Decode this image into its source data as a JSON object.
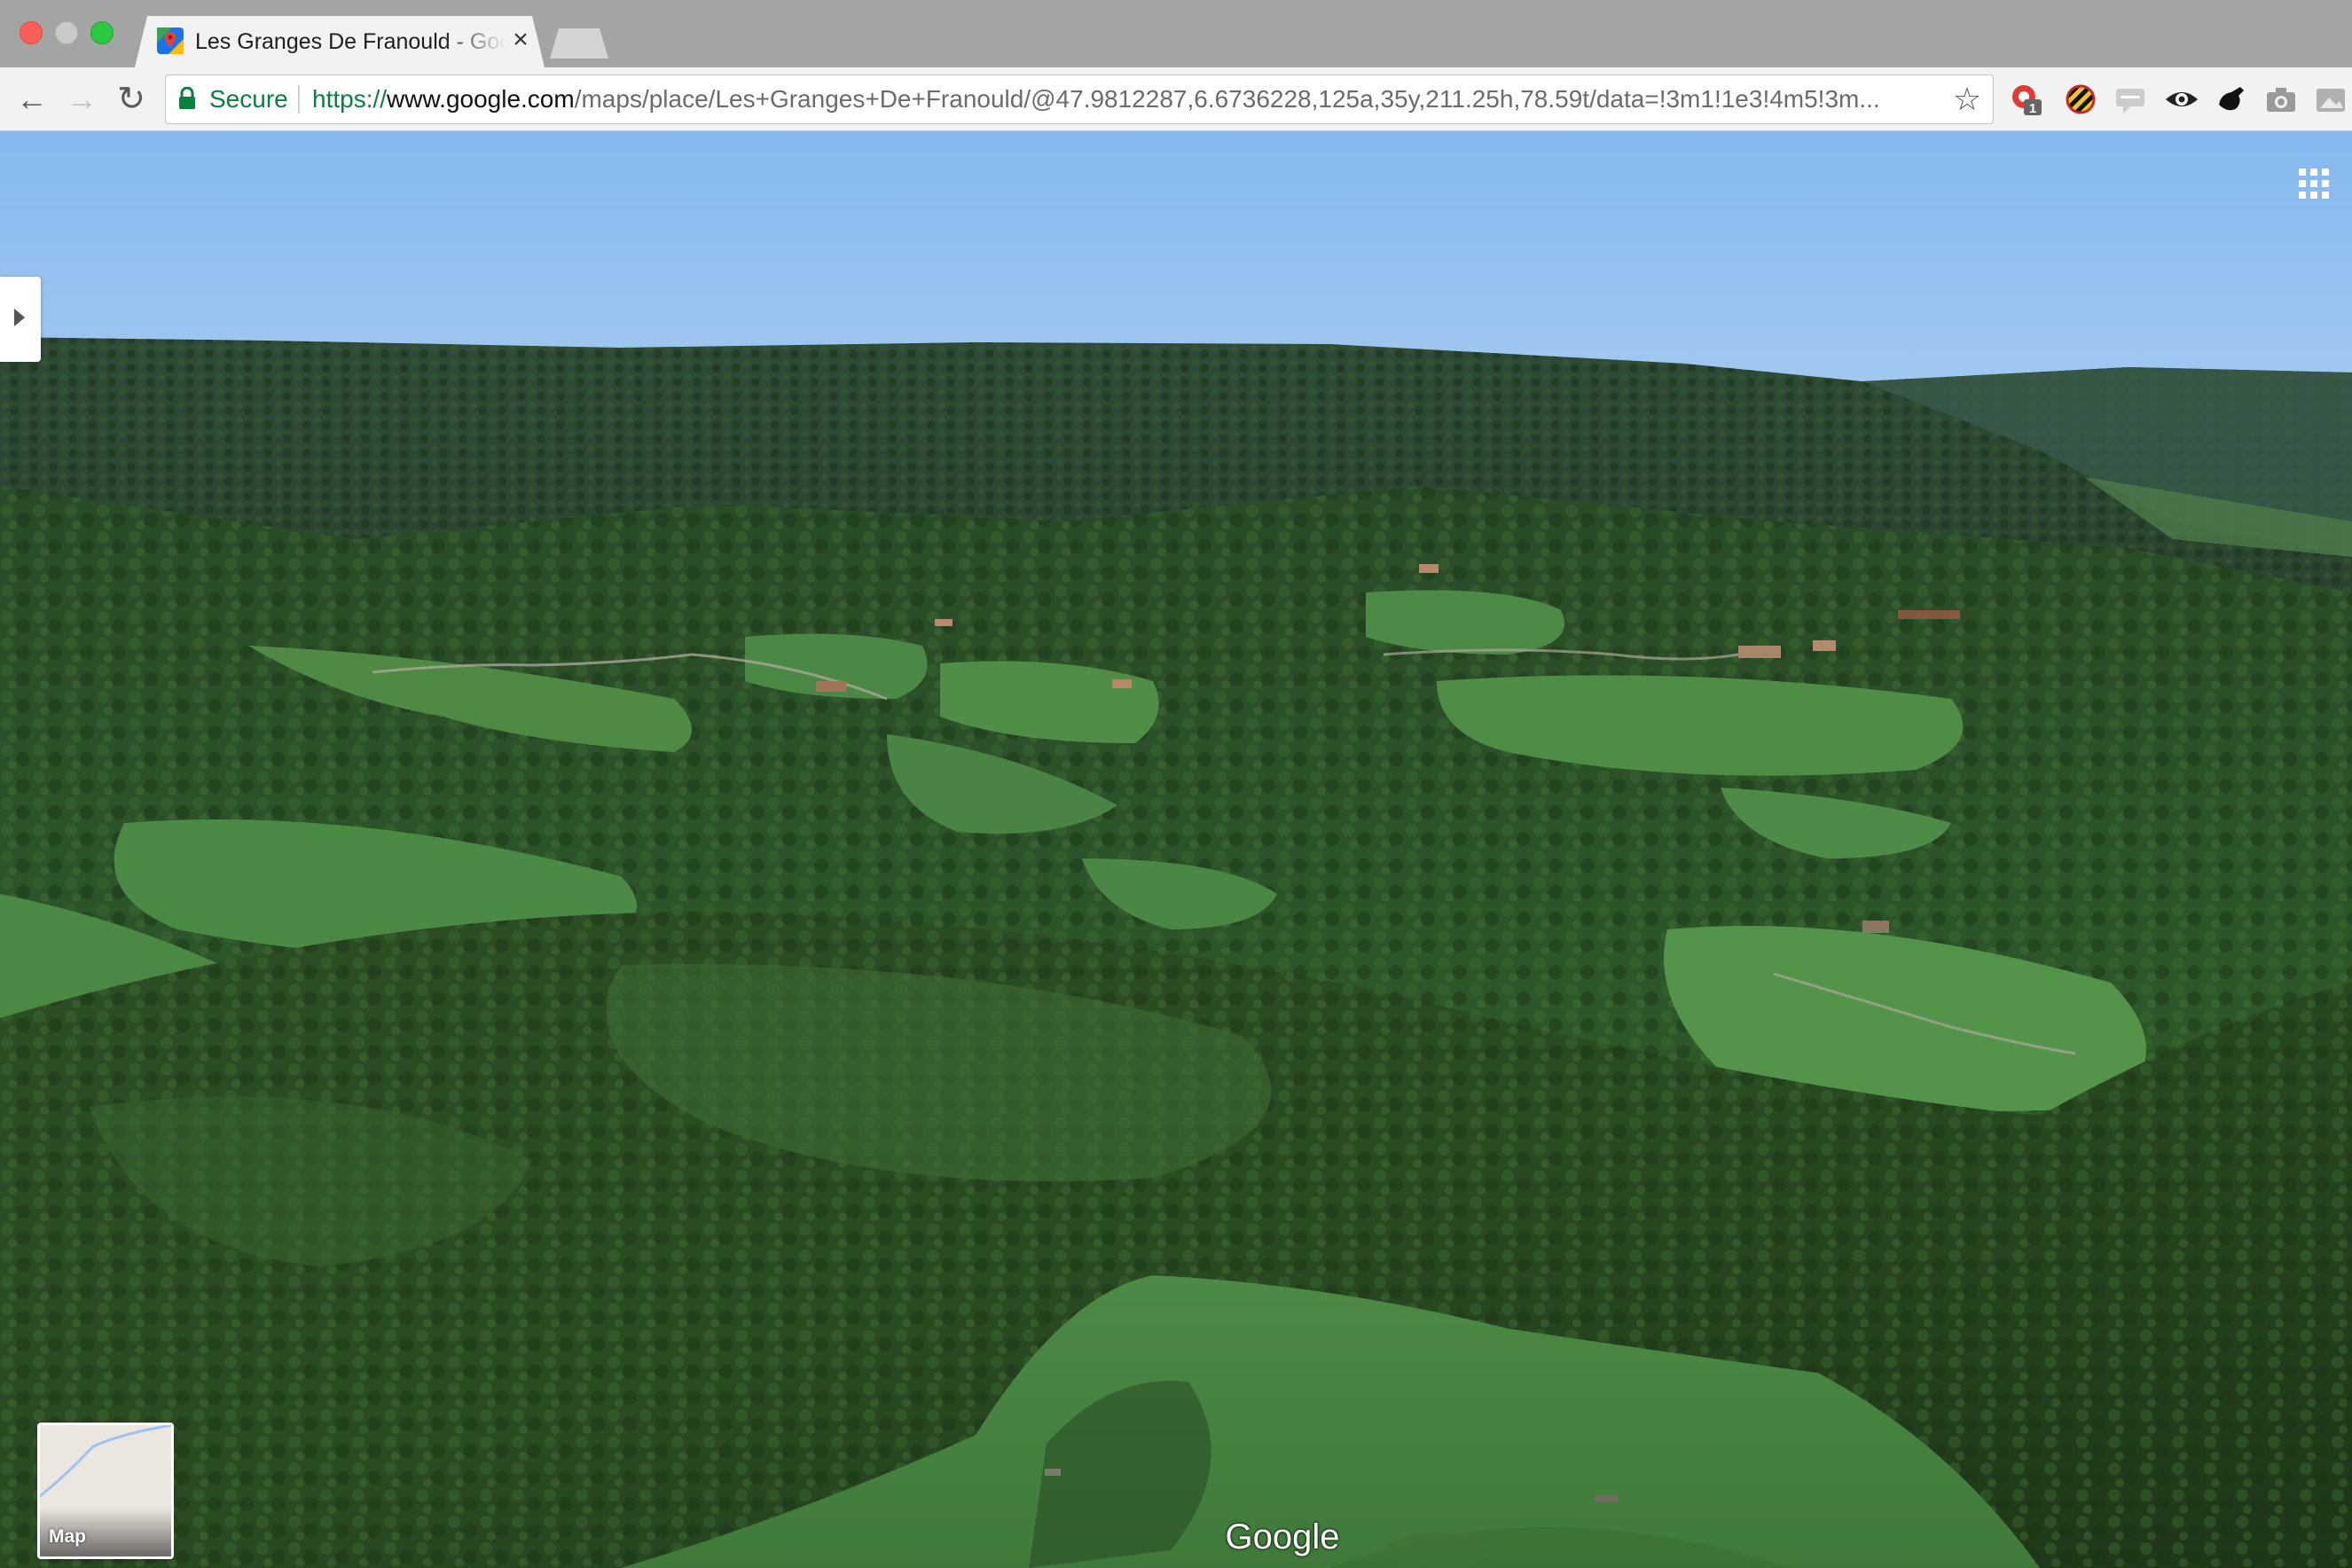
{
  "browser": {
    "tab": {
      "title": "Les Granges De Franould - Google Maps",
      "close_glyph": "×",
      "favicon": "google-maps-icon"
    },
    "nav": {
      "back_glyph": "←",
      "forward_glyph": "→",
      "reload_glyph": "↻"
    },
    "omnibox": {
      "secure_label": "Secure",
      "url_protocol": "https://",
      "url_host": "www.google.com",
      "url_path": "/maps/place/Les+Granges+De+Franould/@47.9812287,6.6736228,125a,35y,211.25h,78.59t/data=!3m1!1e3!4m5!3m...",
      "star_glyph": "☆"
    },
    "extensions": [
      {
        "name": "extension-badge-icon",
        "badge": "1"
      },
      {
        "name": "extension-stripes-icon"
      },
      {
        "name": "extension-chat-icon"
      },
      {
        "name": "extension-eye-icon"
      },
      {
        "name": "extension-hand-icon"
      },
      {
        "name": "extension-camera-icon"
      },
      {
        "name": "extension-image-icon"
      }
    ]
  },
  "map": {
    "view": "3D satellite",
    "thumbnail_label": "Map",
    "logo_text": "Google",
    "colors": {
      "sky_top": "#85b8ee",
      "sky_bottom": "#b5d5f3",
      "forest_dark": "#24401f",
      "meadow": "#4f8a45"
    }
  }
}
